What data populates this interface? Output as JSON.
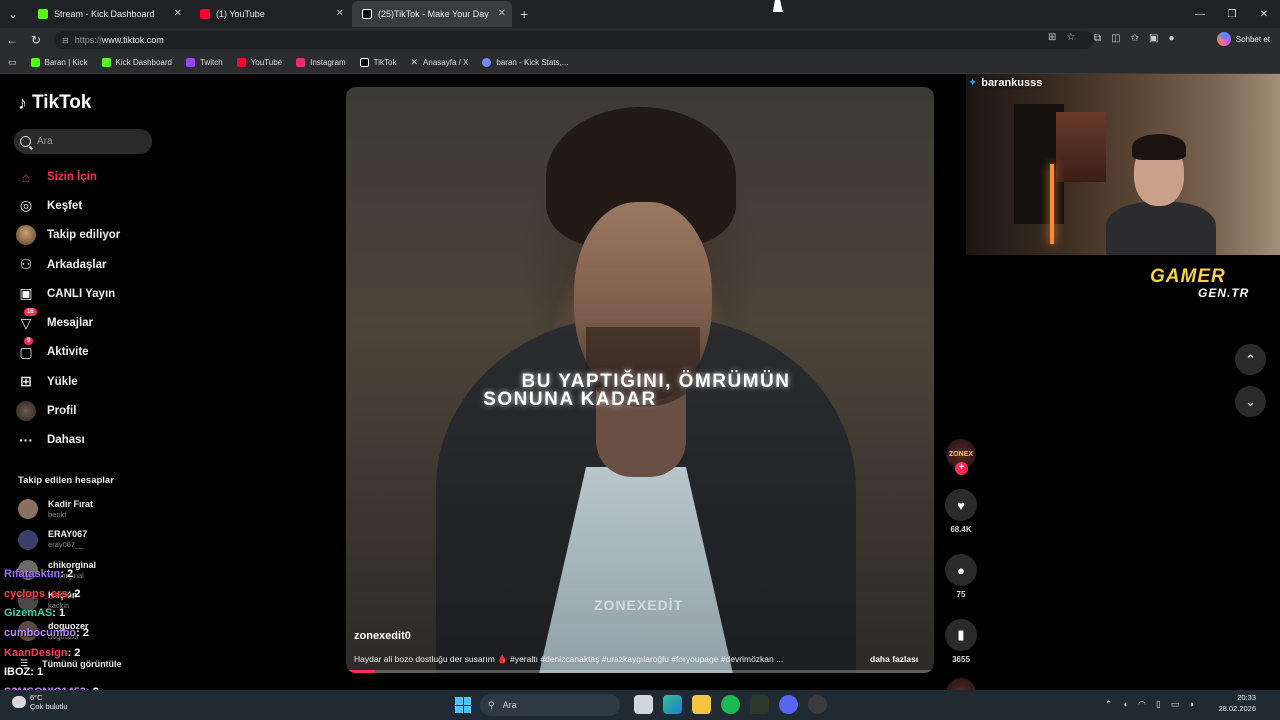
{
  "browser": {
    "tabs": [
      {
        "label": "Stream - Kick Dashboard",
        "color": "#53fc18"
      },
      {
        "label": "(1) YouTube",
        "color": "#ff0033"
      },
      {
        "label": "(25)TikTok - Make Your Day",
        "color": "#ffffff",
        "active": true
      }
    ],
    "url_prefix": "https://",
    "url_host": "www.tiktok.com",
    "copilot_label": "Sohbet et",
    "bookmarks": [
      {
        "label": "Baran | Kick",
        "color": "#53fc18"
      },
      {
        "label": "Kick Dashboard",
        "color": "#53fc18"
      },
      {
        "label": "Twitch",
        "color": "#9146ff"
      },
      {
        "label": "YouTube",
        "color": "#ff0033"
      },
      {
        "label": "Instagram",
        "color": "#e1306c"
      },
      {
        "label": "TikTok",
        "color": "#ffffff"
      },
      {
        "label": "Anasayfa / X",
        "color": "#ffffff"
      },
      {
        "label": "baran - Kick Stats,...",
        "color": "#6c8cff"
      }
    ]
  },
  "tiktok": {
    "logo": "TikTok",
    "search_placeholder": "Ara",
    "menu": [
      {
        "label": "Sizin İçin",
        "icon": "home-icon",
        "active": true
      },
      {
        "label": "Keşfet",
        "icon": "compass-icon"
      },
      {
        "label": "Takip ediliyor",
        "icon": "avatar-icon"
      },
      {
        "label": "Arkadaşlar",
        "icon": "friends-icon"
      },
      {
        "label": "CANLI Yayın",
        "icon": "live-icon"
      },
      {
        "label": "Mesajlar",
        "icon": "messages-icon",
        "badge": "16"
      },
      {
        "label": "Aktivite",
        "icon": "activity-icon",
        "badge": "9"
      },
      {
        "label": "Yükle",
        "icon": "upload-icon"
      },
      {
        "label": "Profil",
        "icon": "profile-icon"
      },
      {
        "label": "Dahası",
        "icon": "more-icon"
      }
    ],
    "following_heading": "Takip edilen hesaplar",
    "following": [
      {
        "name": "Kadir Fırat",
        "handle": "benkf"
      },
      {
        "name": "ERAY067",
        "handle": "eray067__"
      },
      {
        "name": "chikorginal",
        "handle": "chikorginal"
      },
      {
        "name": "Kaçkın",
        "handle": "kackin"
      },
      {
        "name": "doguozer",
        "handle": "doguozer"
      }
    ],
    "see_all": "Tümünü görüntüle",
    "video": {
      "caption_line1": "BU YAPTIĞINI, ÖMRÜMÜN",
      "caption_line2": "SONUNA KADAR",
      "watermark": "ZONEXEDİT",
      "author": "zonexedit0",
      "description": "Haydar ali bozo dostluğu der susarım 🩸 #yeraltı #denizcanaktaş #urazkaygılaroğlu #foryoupage #devrimözkan ...",
      "more": "daha fazlası",
      "progress": 0.05
    },
    "rail": {
      "avatar_text": "ZONEX",
      "likes": "68.4K",
      "comments": "75",
      "saves": "3655"
    }
  },
  "overlay": {
    "handle": "barankusss",
    "brand_line1": "GAMER",
    "brand_line2": "GEN.TR",
    "chat": [
      {
        "user": "Rıfatasktın",
        "count": ": 2",
        "color": "#a06cff"
      },
      {
        "user": "cyclops_ers",
        "count": ": 2",
        "color": "#ff3b3b"
      },
      {
        "user": "GizemAS",
        "count": ": 1",
        "color": "#3ad6b3"
      },
      {
        "user": "cumbocumbo",
        "count": ": 2",
        "color": "#b084ff"
      },
      {
        "user": "KaanDesign",
        "count": ": 2",
        "color": "#ff3b5c"
      },
      {
        "user": "IBOZ",
        "count": ": 1",
        "color": "#ffffff"
      },
      {
        "user": "S2MSONIC1453",
        "count": ": 2",
        "color": "#c77dff"
      }
    ]
  },
  "taskbar": {
    "temp": "6°C",
    "weather": "Çok bulutlu",
    "search": "Ara",
    "time": "20:33",
    "date": "28.02.2026"
  }
}
